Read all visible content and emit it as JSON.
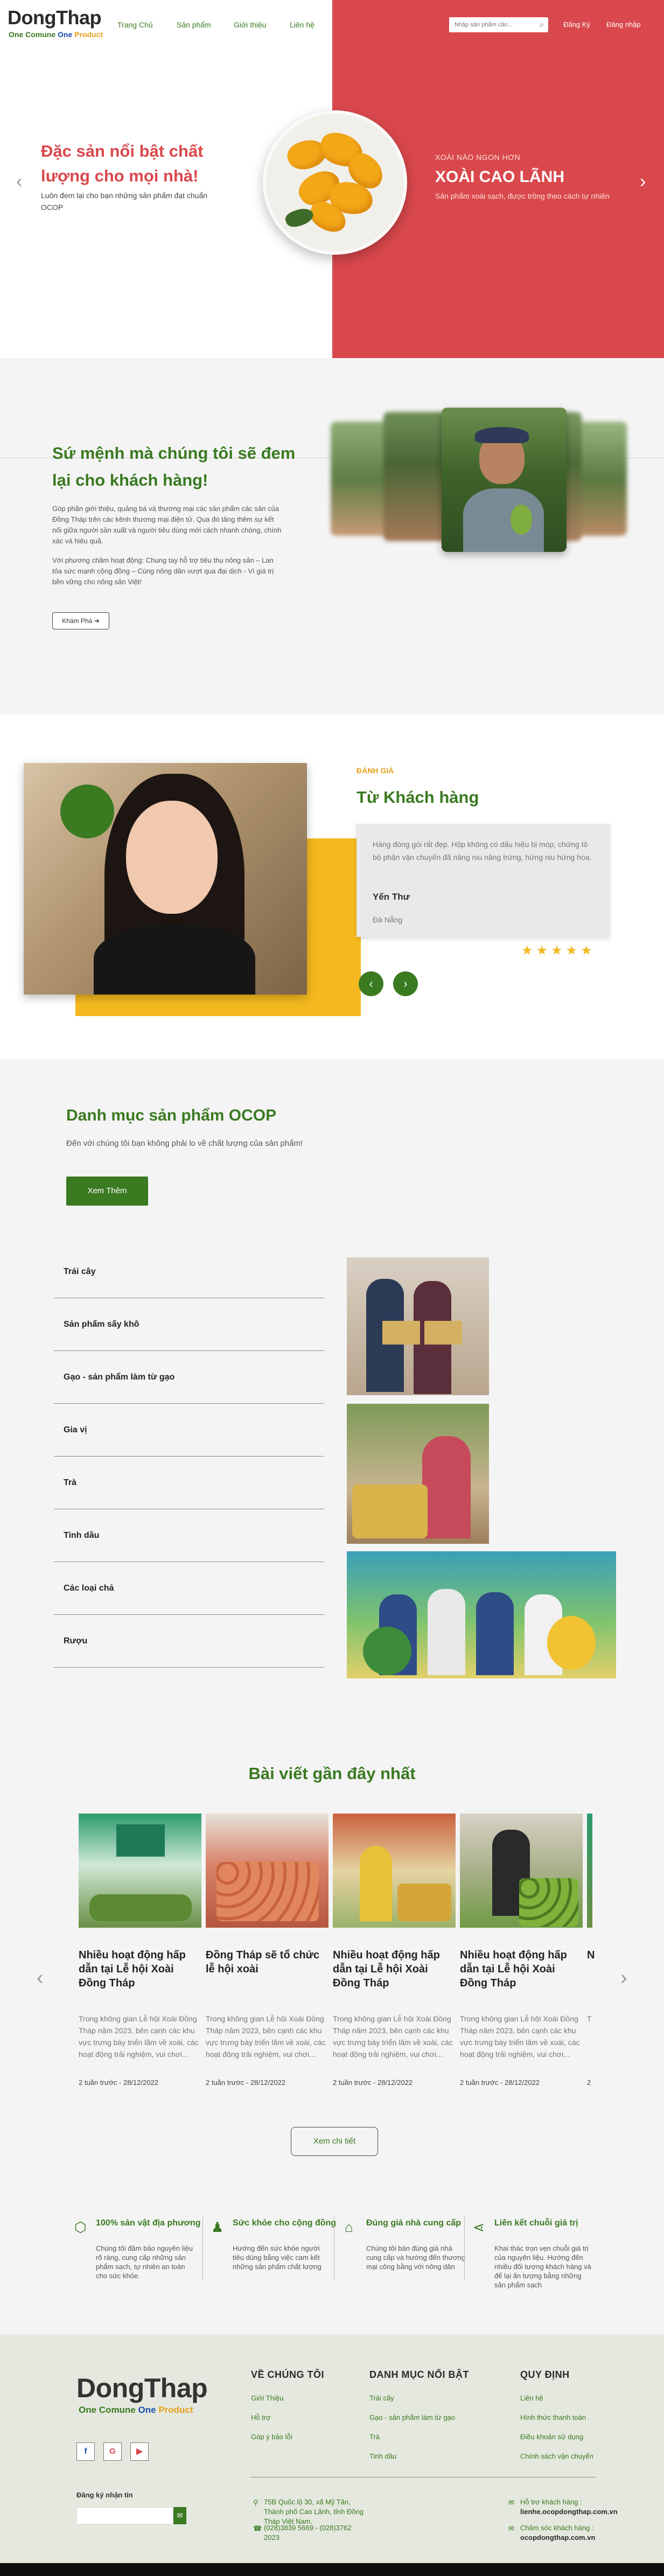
{
  "brand": {
    "name": "DongThap",
    "slogan": [
      "One Comune",
      "One",
      "Product"
    ],
    "colors": {
      "green": "#3a7a21",
      "red": "#d9484c",
      "yellow": "#f4b91f",
      "blue": "#1d4da8"
    }
  },
  "nav": {
    "items": [
      "Trang Chủ",
      "Sản phẩm",
      "Giới thiệu",
      "Liên hệ"
    ],
    "search_placeholder": "Nhập sản phẩm cần...",
    "register": "Đăng Ký",
    "login": "Đăng nhập"
  },
  "hero": {
    "title": "Đặc sản nổi bật chất lượng cho mọi nhà!",
    "description": "Luôn đem lại cho bạn những sản phẩm đạt chuẩn OCOP",
    "kicker": "XOÀI NÀO NGON HƠN",
    "product": "XOÀI CAO LÃNH",
    "product_desc": "Sản phẩm xoài sạch, được trồng theo cách tự nhiên"
  },
  "mission": {
    "title": "Sứ mệnh mà chúng tôi sẽ đem lại cho khách hàng!",
    "p1": "Góp phần giới thiệu, quảng bá và thương mại các sản phẩm các sản của Đồng Tháp trên các kênh thương mại điện tử. Qua đó tăng thêm sự kết nối giữa người sản xuất và người tiêu dùng mới cách nhanh chóng, chính xác và hiệu quả.",
    "p2": "Với phương châm hoạt động: Chung tay hỗ trợ tiêu thụ nông sản – Lan tỏa sức mạnh cộng đồng – Cùng nông dân vượt qua đại dịch - Vì giá trị bền vững cho nông sản Việt!",
    "button": "Khám Phá"
  },
  "testimonial": {
    "kicker": "ĐÁNH GIÁ",
    "title": "Từ Khách hàng",
    "quote": "Hàng đóng gói rất đẹp. Hộp không có dấu hiệu bị móp, chứng tỏ bộ phận vận chuyển đã nâng niu nâng trứng, hứng niu hứng hoa.",
    "name": "Yến Thư",
    "location": "Đà Nẵng",
    "rating": 5,
    "stars": "★★★★★",
    "prev": "‹",
    "next": "›"
  },
  "categories": {
    "title": "Danh mục sản phẩm OCOP",
    "description": "Đến với chúng tôi bạn không phải lo về chất lượng của sản phẩm!",
    "button": "Xem Thêm",
    "items": [
      "Trái cây",
      "Sản phẩm sấy khô",
      "Gạo - sản phẩm làm từ gạo",
      "Gia vị",
      "Trà",
      "Tinh dầu",
      "Các loại chả",
      "Rượu"
    ]
  },
  "posts": {
    "title": "Bài viết gần đây nhất",
    "items": [
      {
        "title": "Nhiều hoạt động hấp dẫn tại Lễ hội Xoài Đồng Tháp",
        "excerpt": "Trong không gian Lễ hội Xoài Đồng Tháp năm 2023, bên cạnh các khu vực trưng bày triển lãm về xoài, các hoạt động trải nghiệm, vui chơi...",
        "meta": "2 tuần trước - 28/12/2022"
      },
      {
        "title": "Đồng Tháp sẽ tổ chức lễ hội xoài",
        "excerpt": "Trong không gian Lễ hội Xoài Đồng Tháp năm 2023, bên cạnh các khu vực trưng bày triển lãm về xoài, các hoạt động trải nghiệm, vui chơi...",
        "meta": "2 tuần trước - 28/12/2022"
      },
      {
        "title": "Nhiều hoạt động hấp dẫn tại Lễ hội Xoài Đồng Tháp",
        "excerpt": "Trong không gian Lễ hội Xoài Đồng Tháp năm 2023, bên cạnh các khu vực trưng bày triển lãm về xoài, các hoạt động trải nghiệm, vui chơi...",
        "meta": "2 tuần trước - 28/12/2022"
      },
      {
        "title": "Nhiều hoạt động hấp dẫn tại Lễ hội Xoài Đồng Tháp",
        "excerpt": "Trong không gian Lễ hội Xoài Đồng Tháp năm 2023, bên cạnh các khu vực trưng bày triển lãm về xoài, các hoạt động trải nghiệm, vui chơi...",
        "meta": "2 tuần trước - 28/12/2022"
      },
      {
        "title": "N",
        "excerpt": "T",
        "meta": "2"
      }
    ],
    "button": "Xem chi tiết"
  },
  "features": [
    {
      "icon": "box-icon",
      "title": "100% sản vật địa phương",
      "desc": "Chúng tôi đảm bảo nguyên liệu rõ ràng, cung cấp những sản phẩm sạch, tự nhiên an toàn cho sức khỏe."
    },
    {
      "icon": "users-icon",
      "title": "Sức khỏe cho cộng đồng",
      "desc": "Hướng đến sức khỏe người tiêu dùng bằng việc cam kết những sản phẩm chất lượng"
    },
    {
      "icon": "tag-icon",
      "title": "Đúng giá nhà cung cấp",
      "desc": "Chúng tôi bán đúng giá nhà cung cấp và hướng đến thương mại công bằng với nông dân"
    },
    {
      "icon": "share-icon",
      "title": "Liên kết chuỗi giá trị",
      "desc": "Khai thác trọn vẹn chuỗi giá trị của nguyên liệu. Hướng đến nhiều đối tượng khách hàng và để lại ấn tượng bằng những sản phẩm sạch"
    }
  ],
  "footer": {
    "social": [
      "f",
      "G",
      "▶"
    ],
    "subscribe_label": "Đăng ký nhận tin",
    "subscribe_button": "✉",
    "col1": {
      "heading": "VỀ CHÚNG TÔI",
      "links": [
        "Giới Thiệu",
        "Hỗ trợ",
        "Góp ý bảo lỗi"
      ]
    },
    "col2": {
      "heading": "DANH MỤC NỔI BẬT",
      "links": [
        "Trái cây",
        "Gạo - sản phẩm làm từ gạo",
        "Trà",
        "Tinh dầu"
      ]
    },
    "col3": {
      "heading": "QUY ĐỊNH",
      "links": [
        "Liên hệ",
        "Hình thức thanh toán",
        "Điều khoản sử dụng",
        "Chính sách vận chuyển"
      ]
    },
    "address": "75B Quốc lộ 30, xã Mỹ Tân, Thành phố Cao Lãnh, tỉnh Đồng Tháp Việt Nam.",
    "phone": "(028)3839 5669 - (028)3762 2023",
    "support_label": "Hỗ trợ khách hàng :",
    "support_email": "lienhe.ocopdongthap.com.vn",
    "partner_label": "Chăm sóc khách hàng :",
    "partner_email": "ocopdongthap.com.vn"
  }
}
